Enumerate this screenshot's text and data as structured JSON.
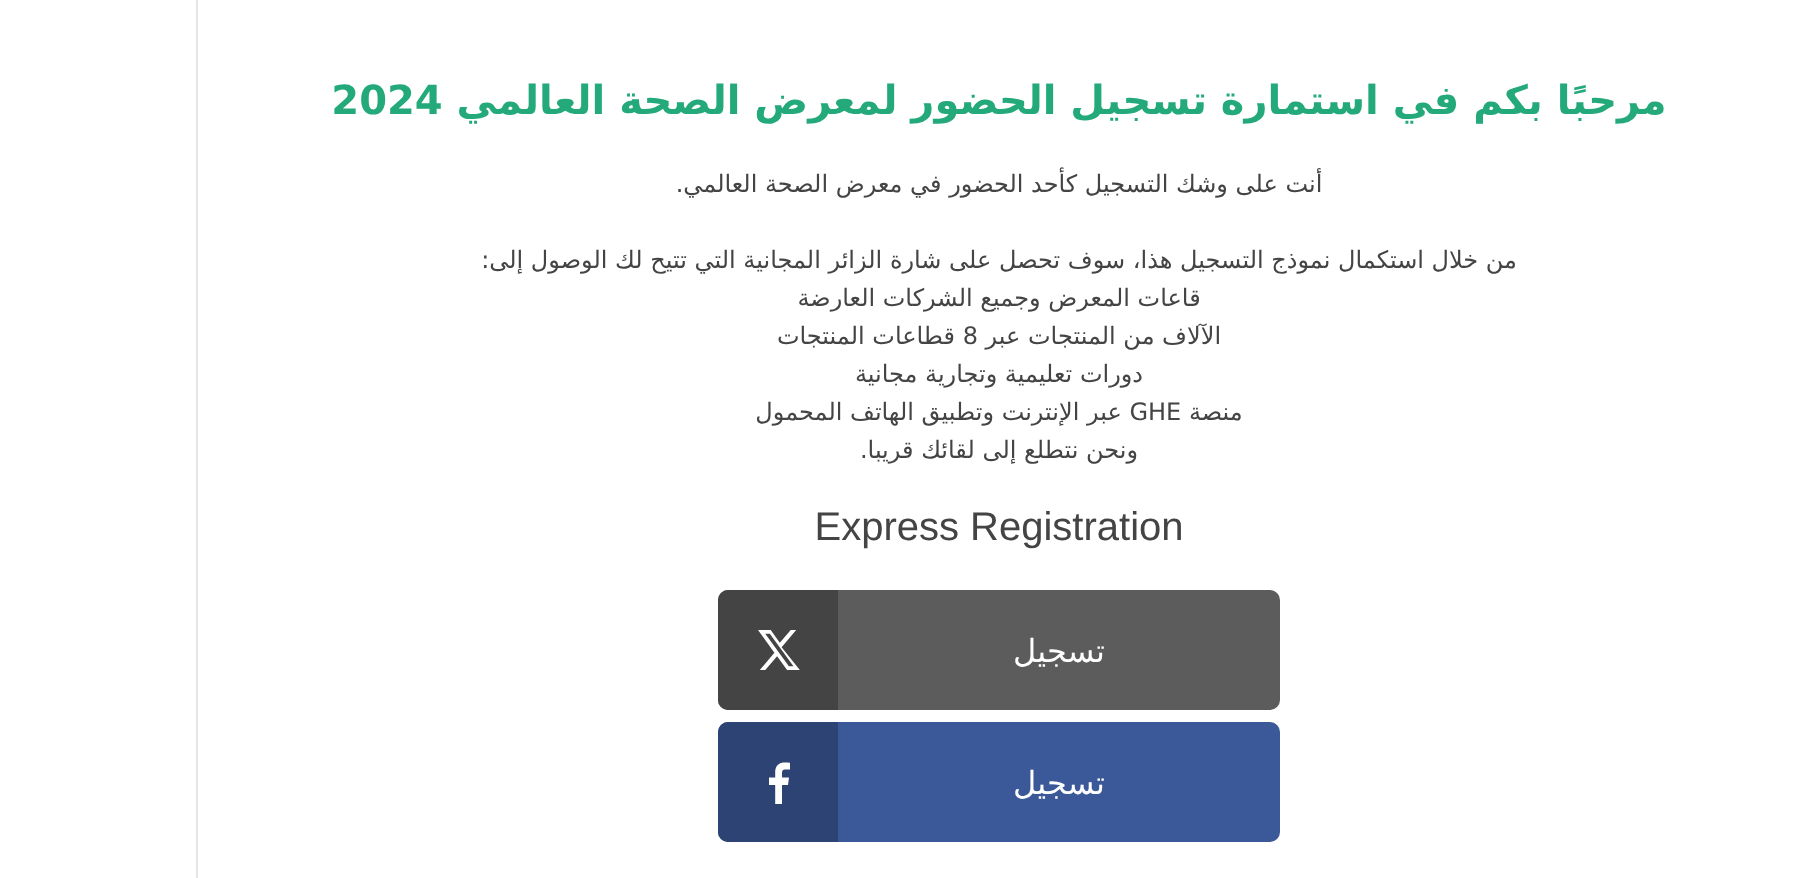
{
  "heading": "مرحبًا بكم في استمارة تسجيل الحضور لمعرض الصحة العالمي 2024",
  "intro": "أنت على وشك التسجيل كأحد الحضور في معرض الصحة العالمي.",
  "lead": "من خلال استكمال نموذج التسجيل هذا، سوف تحصل على شارة الزائر المجانية التي تتيح لك الوصول إلى:",
  "benefits": [
    "قاعات المعرض وجميع الشركات العارضة",
    "الآلاف من المنتجات عبر 8 قطاعات المنتجات",
    "دورات تعليمية وتجارية مجانية",
    "منصة GHE عبر الإنترنت وتطبيق الهاتف المحمول",
    "ونحن نتطلع إلى لقائك قريبا."
  ],
  "express_title": "Express Registration",
  "buttons": [
    {
      "kind": "x",
      "label": "تسجيل"
    },
    {
      "kind": "facebook",
      "label": "تسجيل"
    }
  ]
}
